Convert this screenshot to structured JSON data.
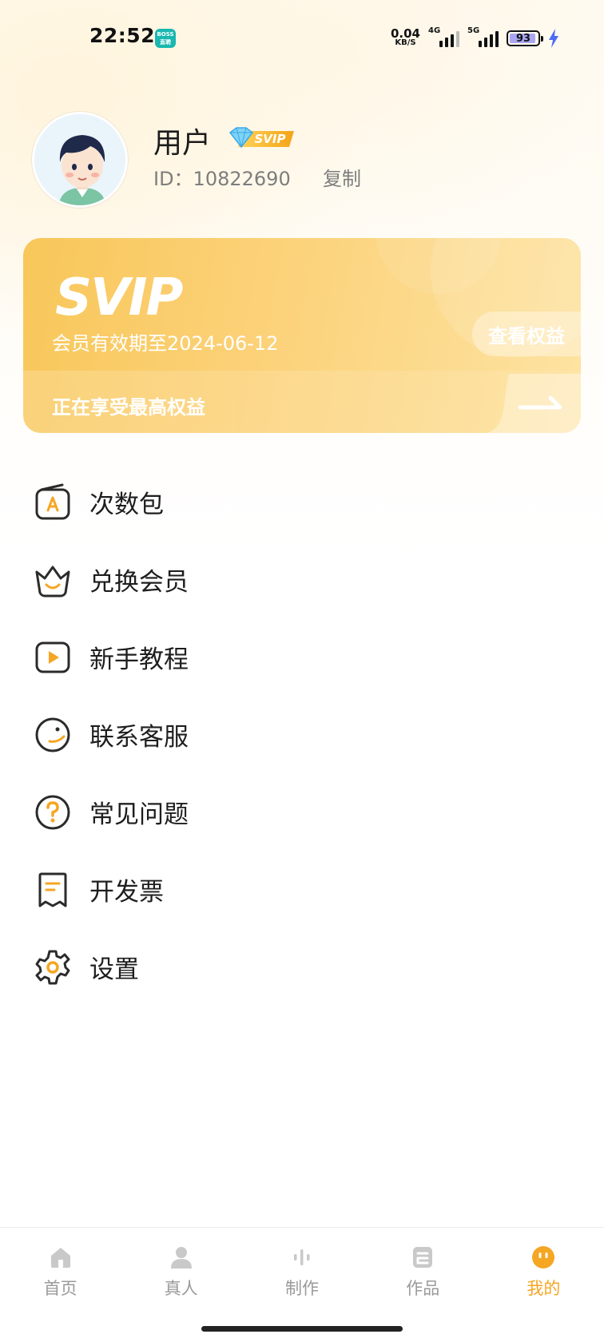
{
  "status_bar": {
    "time": "22:52",
    "app_icon_text": "BOSS\n直聘",
    "net_speed_value": "0.04",
    "net_speed_unit": "KB/S",
    "signal_1_label": "4G",
    "signal_2_label": "5G",
    "battery": "93"
  },
  "profile": {
    "username": "用户",
    "badge": "SVIP",
    "user_id": "ID：10822690",
    "copy_label": "复制"
  },
  "svip_card": {
    "logo_text": "SVIP",
    "expiry": "会员有效期至2024-06-12",
    "view_benefits": "查看权益",
    "benefit_status": "正在享受最高权益"
  },
  "menu": {
    "items": [
      {
        "label": "次数包",
        "icon": "package-icon"
      },
      {
        "label": "兑换会员",
        "icon": "crown-icon"
      },
      {
        "label": "新手教程",
        "icon": "play-icon"
      },
      {
        "label": "联系客服",
        "icon": "smile-icon"
      },
      {
        "label": "常见问题",
        "icon": "question-icon"
      },
      {
        "label": "开发票",
        "icon": "invoice-icon"
      },
      {
        "label": "设置",
        "icon": "gear-icon"
      }
    ]
  },
  "tabs": [
    {
      "label": "首页",
      "icon": "home-icon"
    },
    {
      "label": "真人",
      "icon": "person-icon"
    },
    {
      "label": "制作",
      "icon": "waveform-icon"
    },
    {
      "label": "作品",
      "icon": "works-icon"
    },
    {
      "label": "我的",
      "icon": "profile-face-icon",
      "active": true
    }
  ],
  "colors": {
    "accent": "#f5a623",
    "card_gradient_start": "#f8c75a",
    "card_gradient_end": "#fde3a2",
    "icon_stroke": "#2b2b2b",
    "tab_inactive": "#9a9a9a"
  }
}
